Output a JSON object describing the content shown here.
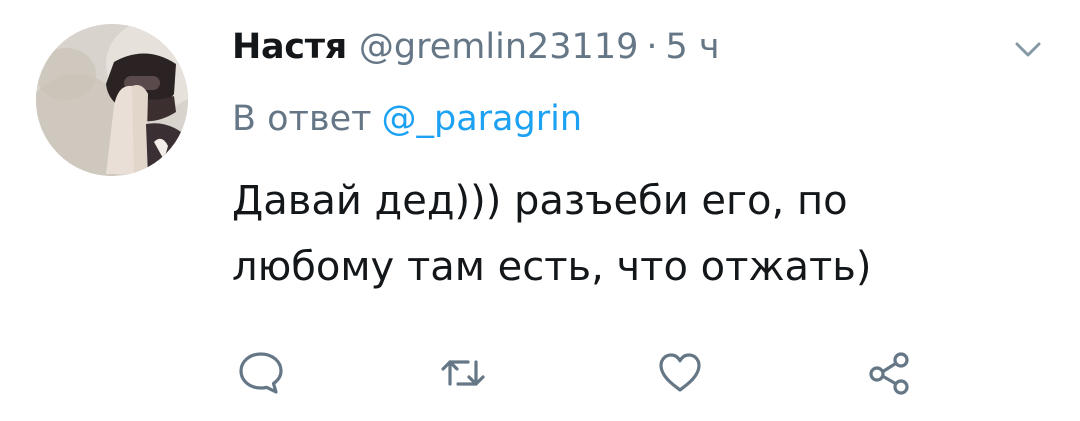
{
  "tweet": {
    "display_name": "Настя",
    "handle": "@gremlin23119",
    "separator": "·",
    "time": "5 ч",
    "reply_prefix": "В ответ",
    "reply_to": "@_paragrin",
    "text_lines": [
      "Давай дед))) разъеби его, по",
      "любому там есть, что отжать)"
    ]
  },
  "icons": {
    "menu": "chevron-down-icon",
    "reply": "reply-bubble-icon",
    "retweet": "retweet-icon",
    "like": "heart-icon",
    "share": "share-icon"
  },
  "colors": {
    "text_primary": "#14171a",
    "text_secondary": "#657786",
    "link": "#1da1f2",
    "background": "#ffffff"
  }
}
